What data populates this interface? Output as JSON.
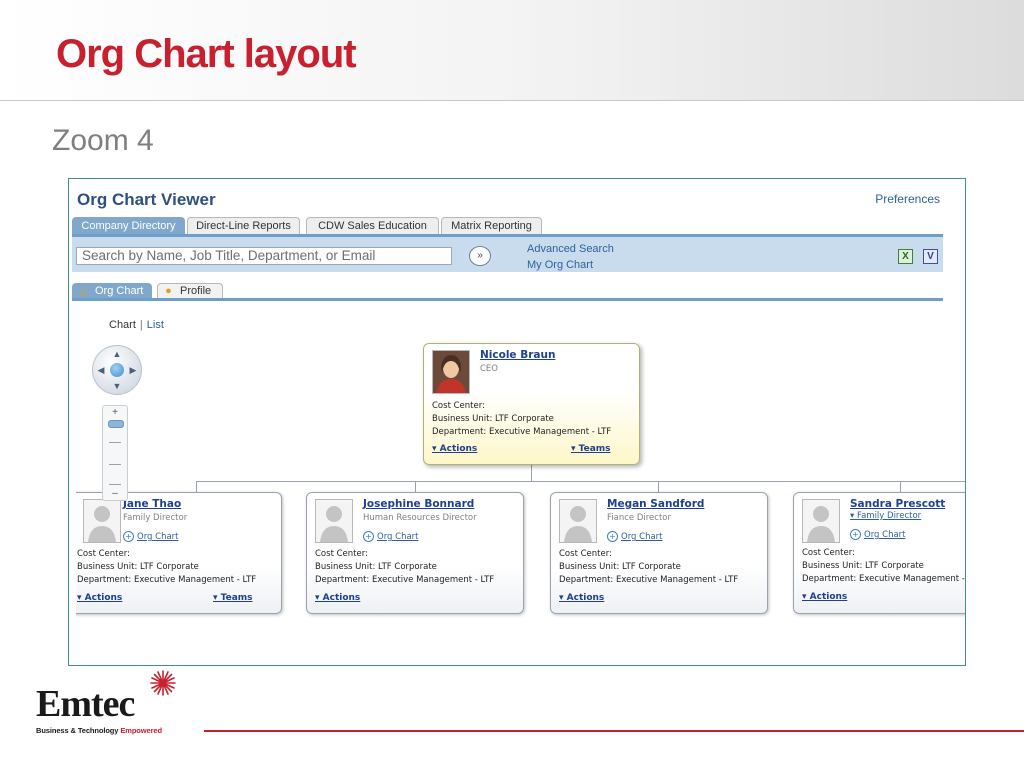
{
  "slide": {
    "title": "Org Chart layout",
    "subtitle": "Zoom 4"
  },
  "viewer": {
    "title": "Org Chart Viewer",
    "preferences": "Preferences",
    "tabs": [
      "Company Directory",
      "Direct-Line Reports",
      "CDW Sales Education",
      "Matrix Reporting"
    ],
    "active_tab": "Company Directory",
    "search": {
      "placeholder": "Search by Name, Job Title, Department, or Email",
      "go_symbol": "»",
      "advanced": "Advanced Search",
      "my_org_chart": "My Org Chart",
      "excel": "X",
      "visio": "V"
    },
    "sub_tabs": [
      "Org Chart",
      "Profile"
    ],
    "active_sub_tab": "Org Chart",
    "view_toggle": {
      "chart": "Chart",
      "list": "List"
    }
  },
  "cards": {
    "ceo": {
      "name": "Nicole Braun",
      "title": "CEO",
      "cost_center": "Cost Center:",
      "business_unit": "Business Unit: LTF Corporate",
      "department": "Department: Executive Management - LTF",
      "actions": "▾ Actions",
      "teams": "▾ Teams"
    },
    "reports": [
      {
        "name": "Jane Thao",
        "title": "Family Director",
        "org_chart": "Org Chart",
        "cost_center": "Cost Center:",
        "business_unit": "Business Unit: LTF Corporate",
        "department": "Department: Executive Management - LTF",
        "actions": "▾ Actions",
        "teams": "▾ Teams"
      },
      {
        "name": "Josephine Bonnard",
        "title": "Human Resources Director",
        "org_chart": "Org Chart",
        "cost_center": "Cost Center:",
        "business_unit": "Business Unit: LTF Corporate",
        "department": "Department: Executive Management - LTF",
        "actions": "▾ Actions"
      },
      {
        "name": "Megan Sandford",
        "title": "Fiance Director",
        "org_chart": "Org Chart",
        "cost_center": "Cost Center:",
        "business_unit": "Business Unit: LTF Corporate",
        "department": "Department: Executive Management - LTF",
        "actions": "▾ Actions"
      },
      {
        "name": "Sandra Prescott",
        "title": "▾ Family Director",
        "org_chart": "Org Chart",
        "cost_center": "Cost Center:",
        "business_unit": "Business Unit: LTF Corporate",
        "department": "Department: Executive Management - LTF",
        "actions": "▾ Actions"
      }
    ]
  },
  "logo": {
    "word": "Emtec",
    "tag_black": "Business & Technology",
    "tag_red": "Empowered"
  },
  "colors": {
    "title_red": "#c8202f",
    "viewer_blue": "#2f4f7f",
    "tab_active": "#7fa8cc",
    "ceo_card": "#fdf7c8"
  }
}
